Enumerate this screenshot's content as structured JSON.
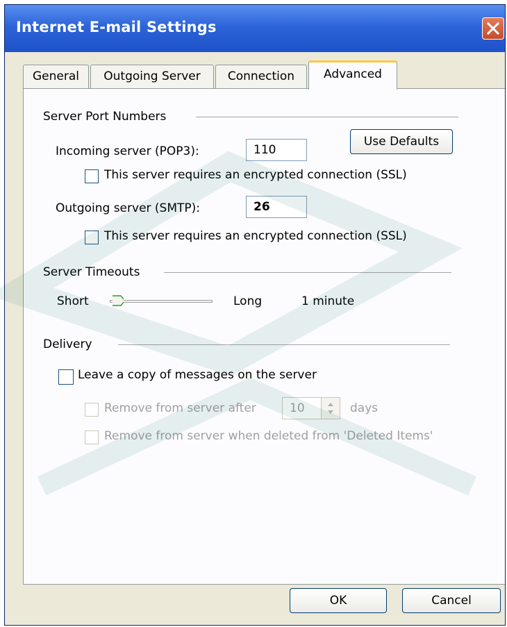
{
  "dialog": {
    "title": "Internet E-mail Settings",
    "close_icon": "close-icon"
  },
  "tabs": [
    {
      "label": "General"
    },
    {
      "label": "Outgoing Server"
    },
    {
      "label": "Connection"
    },
    {
      "label": "Advanced",
      "active": true
    }
  ],
  "ports": {
    "group_label": "Server Port Numbers",
    "incoming_label": "Incoming server (POP3):",
    "incoming_value": "110",
    "use_defaults_label": "Use Defaults",
    "incoming_ssl_label": "This server requires an encrypted connection (SSL)",
    "outgoing_label": "Outgoing server (SMTP):",
    "outgoing_value": "26",
    "outgoing_ssl_label": "This server requires an encrypted connection (SSL)"
  },
  "timeouts": {
    "group_label": "Server Timeouts",
    "short_label": "Short",
    "long_label": "Long",
    "value_label": "1 minute",
    "slider_level": 0.08
  },
  "delivery": {
    "group_label": "Delivery",
    "leave_copy_label": "Leave a copy of messages on the server",
    "remove_after_label": "Remove from server after",
    "remove_after_value": "10",
    "days_label": "days",
    "remove_deleted_label": "Remove from server when deleted from 'Deleted Items'"
  },
  "buttons": {
    "ok": "OK",
    "cancel": "Cancel"
  },
  "colors": {
    "titlebar": "#2d64d8",
    "face": "#ece9d8",
    "tab_highlight": "#ffc83c"
  }
}
